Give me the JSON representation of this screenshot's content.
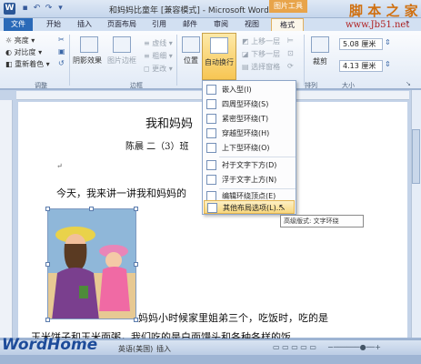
{
  "title_bar": {
    "title": "和妈妈比童年 [兼容模式] - Microsoft Word",
    "contextual_tab": "图片工具",
    "watermark_site": "脚 本 之 家",
    "watermark_url": "www.Jb51.net"
  },
  "tabs": [
    "文件",
    "开始",
    "插入",
    "页面布局",
    "引用",
    "邮件",
    "审阅",
    "视图",
    "格式"
  ],
  "ribbon": {
    "adjust": {
      "brightness": "亮度",
      "contrast": "对比度",
      "recolor": "重新着色",
      "label": "调整"
    },
    "styles": {
      "shadow": "阴影效果",
      "border": "图片边框",
      "label": "边框"
    },
    "arrange": {
      "position": "位置",
      "wrap": "自动换行",
      "bring_forward": "上移一层",
      "send_backward": "下移一层",
      "selection_pane": "选择窗格",
      "label": "排列"
    },
    "size": {
      "height": "5.08 厘米",
      "width": "4.13 厘米",
      "crop": "裁剪",
      "label": "大小"
    }
  },
  "wrap_menu": {
    "items": [
      {
        "label": "嵌入型(I)",
        "highlighted": false
      },
      {
        "label": "四周型环绕(S)",
        "highlighted": false
      },
      {
        "label": "紧密型环绕(T)",
        "highlighted": false
      },
      {
        "label": "穿越型环绕(H)",
        "highlighted": false
      },
      {
        "label": "上下型环绕(O)",
        "highlighted": false
      },
      {
        "label": "衬于文字下方(D)",
        "highlighted": false
      },
      {
        "label": "浮于文字上方(N)",
        "highlighted": false
      },
      {
        "label": "编辑环绕顶点(E)",
        "highlighted": false
      },
      {
        "label": "其他布局选项(L)...",
        "highlighted": true
      }
    ],
    "tooltip": "高级版式: 文字环绕"
  },
  "document": {
    "heading": "我和妈妈",
    "byline": "陈晨  二（3）班",
    "para1": "今天，我来讲一讲我和妈妈的",
    "para2": "妈妈小时候家里姐弟三个，吃饭时，吃的是",
    "para3": "玉米饼子和玉米面粥，我们吃的是白面馒头和各种各样的饭",
    "return_mark": "↵"
  },
  "status_bar": {
    "language": "英语(美国)",
    "mode": "插入",
    "logo": "WordHome"
  },
  "colors": {
    "file_tab": "#2a6ab8",
    "contextual_accent": "#e8a44a",
    "highlight": "#f8d77e"
  }
}
